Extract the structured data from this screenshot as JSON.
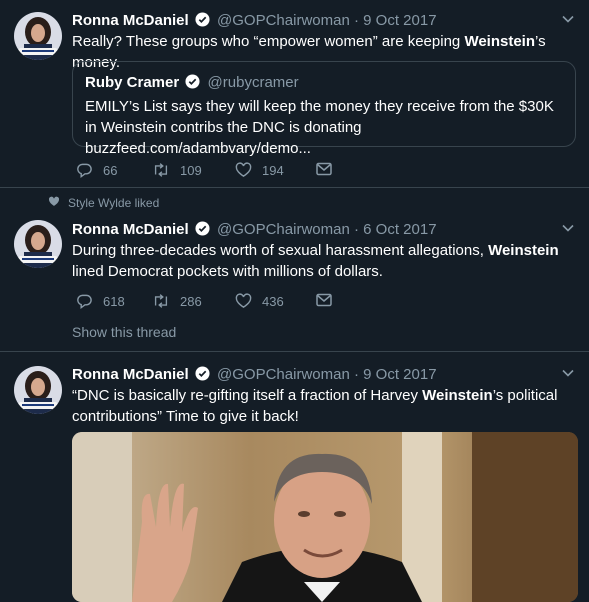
{
  "tweets": [
    {
      "name": "Ronna McDaniel",
      "handle": "@GOPChairwoman",
      "date": "9 Oct 2017",
      "text_pre": "Really? These groups who “empower women” are keeping ",
      "text_bold": "Weinstein",
      "text_post": "’s money.",
      "quote": {
        "name": "Ruby Cramer",
        "handle": "@rubycramer",
        "text": "EMILY’s List says they will keep the money they receive from the $30K in Weinstein contribs the DNC is donating buzzfeed.com/adambvary/demo..."
      },
      "replies": "66",
      "retweets": "109",
      "likes": "194"
    },
    {
      "liked_by": "Style Wylde liked",
      "name": "Ronna McDaniel",
      "handle": "@GOPChairwoman",
      "date": "6 Oct 2017",
      "text_pre": "During three-decades worth of sexual harassment allegations, ",
      "text_bold": "Weinstein",
      "text_post": " lined Democrat pockets with millions of dollars.",
      "replies": "618",
      "retweets": "286",
      "likes": "436",
      "show_thread": "Show this thread"
    },
    {
      "name": "Ronna McDaniel",
      "handle": "@GOPChairwoman",
      "date": "9 Oct 2017",
      "text_pre": "“DNC is basically re-gifting itself a fraction of Harvey ",
      "text_bold": "Weinstein",
      "text_post": "’s political contributions” Time to give it back!"
    }
  ],
  "colors": {
    "background": "#141d26",
    "border": "#38444d",
    "muted": "#8899a6",
    "verified": "#ffffff"
  },
  "icons": [
    "reply-icon",
    "retweet-icon",
    "like-icon",
    "dm-icon",
    "chevron-down-icon",
    "verified-icon",
    "heart-icon"
  ]
}
